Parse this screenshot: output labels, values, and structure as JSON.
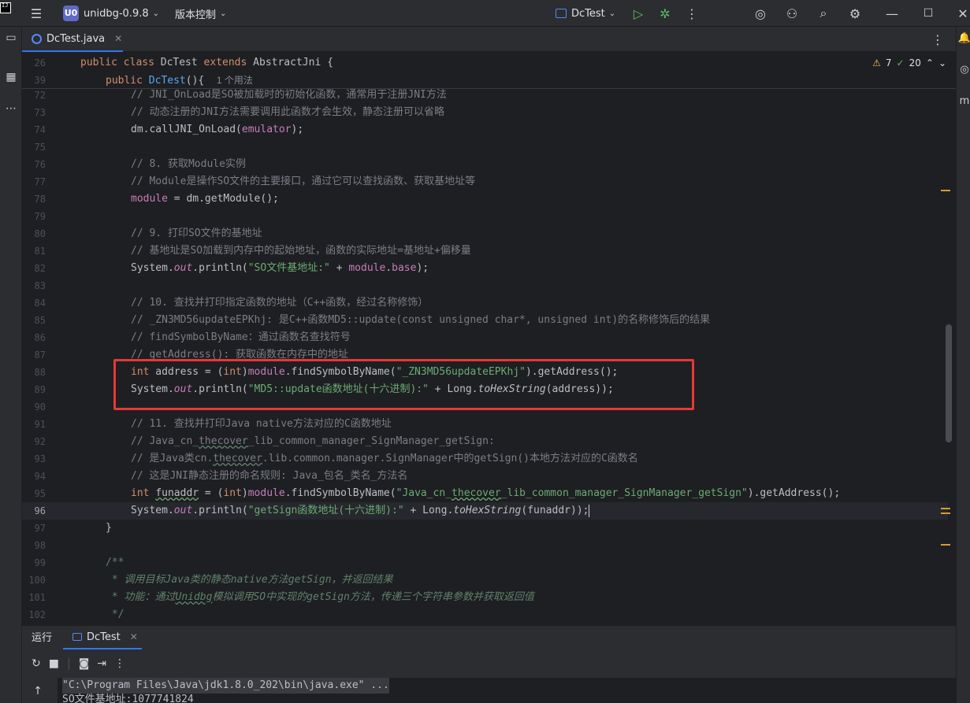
{
  "titlebar": {
    "project_badge": "U0",
    "project_name": "unidbg-0.9.8",
    "vcs_label": "版本控制",
    "run_config": "DcTest"
  },
  "tabs": [
    {
      "label": "DcTest.java",
      "active": true
    }
  ],
  "inspections": {
    "warnings": "7",
    "ok": "20"
  },
  "sticky": [
    {
      "line": "26",
      "kw1": "public class ",
      "name": "DcTest",
      "kw2": " extends ",
      "parent": "AbstractJni",
      "rest": " {"
    },
    {
      "line": "39",
      "kw": "public ",
      "name": "DcTest",
      "rest": "(){",
      "hint": "1 个用法"
    }
  ],
  "code": {
    "l72": {
      "n": "72",
      "text": "// JNI_OnLoad是SO被加载时的初始化函数，通常用于注册JNI方法"
    },
    "l73": {
      "n": "73",
      "text": "// 动态注册的JNI方法需要调用此函数才会生效，静态注册可以省略"
    },
    "l74": {
      "n": "74",
      "a": "dm.callJNI_OnLoad(",
      "b": "emulator",
      "c": ");"
    },
    "l75": {
      "n": "75"
    },
    "l76": {
      "n": "76",
      "text": "// 8. 获取Module实例"
    },
    "l77": {
      "n": "77",
      "text": "// Module是操作SO文件的主要接口，通过它可以查找函数、获取基地址等"
    },
    "l78": {
      "n": "78",
      "a": "module",
      "b": " = dm.getModule();"
    },
    "l79": {
      "n": "79"
    },
    "l80": {
      "n": "80",
      "text": "// 9. 打印SO文件的基地址"
    },
    "l81": {
      "n": "81",
      "text": "// 基地址是SO加载到内存中的起始地址，函数的实际地址=基地址+偏移量"
    },
    "l82": {
      "n": "82",
      "a": "System.",
      "b": "out",
      "c": ".println(",
      "d": "\"SO文件基地址:\"",
      "e": " + ",
      "f": "module",
      "g": ".",
      "h": "base",
      "i": ");"
    },
    "l83": {
      "n": "83"
    },
    "l84": {
      "n": "84",
      "text": "// 10. 查找并打印指定函数的地址（C++函数，经过名称修饰）"
    },
    "l85": {
      "n": "85",
      "text": "// _ZN3MD56updateEPKhj: 是C++函数MD5::update(const unsigned char*, unsigned int)的名称修饰后的结果"
    },
    "l86": {
      "n": "86",
      "text": "// findSymbolByName：通过函数名查找符号"
    },
    "l87": {
      "n": "87",
      "text": "// getAddress(): 获取函数在内存中的地址"
    },
    "l88": {
      "n": "88",
      "a": "int",
      "b": " address = (",
      "c": "int",
      "d": ")",
      "e": "module",
      "f": ".findSymbolByName(",
      "g": "\"_ZN3MD56updateEPKhj\"",
      "h": ").getAddress();"
    },
    "l89": {
      "n": "89",
      "a": "System.",
      "b": "out",
      "c": ".println(",
      "d": "\"MD5::update函数地址(十六进制):\"",
      "e": " + Long.",
      "f": "toHexString",
      "g": "(address));"
    },
    "l90": {
      "n": "90"
    },
    "l91": {
      "n": "91",
      "text": "// 11. 查找并打印Java native方法对应的C函数地址"
    },
    "l92": {
      "n": "92",
      "a": "// Java_cn_",
      "b": "thecover",
      "c": "_lib_common_manager_SignManager_getSign:"
    },
    "l93": {
      "n": "93",
      "a": "// 是Java类cn.",
      "b": "thecover",
      "c": ".lib.common.manager.SignManager中的getSign()本地方法对应的C函数名"
    },
    "l94": {
      "n": "94",
      "text": "// 这是JNI静态注册的命名规则: Java_包名_类名_方法名"
    },
    "l95": {
      "n": "95",
      "a": "int",
      "b": " ",
      "c": "funaddr",
      "d": " = (",
      "e": "int",
      "f": ")",
      "g": "module",
      "h": ".findSymbolByName(",
      "i": "\"Java_cn_",
      "j": "thecover",
      "k": "_lib_common_manager_SignManager_getSign\"",
      "l": ").getAddress();"
    },
    "l96": {
      "n": "96",
      "a": "System.",
      "b": "out",
      "c": ".println(",
      "d": "\"getSign函数地址(十六进制):\"",
      "e": " + Long.",
      "f": "toHexString",
      "g": "(funaddr));"
    },
    "l97": {
      "n": "97",
      "text": "}"
    },
    "l98": {
      "n": "98"
    },
    "l99": {
      "n": "99",
      "text": "/**"
    },
    "l100": {
      "n": "100",
      "a": " * ",
      "b": "调用目标Java类的静态native方法getSign，并返回结果"
    },
    "l101": {
      "n": "101",
      "a": " * ",
      "b": "功能：通过",
      "c": "Unidbg",
      "d": "模拟调用SO中实现的getSign方法，传递三个字符串参数并获取返回值"
    },
    "l102": {
      "n": "102",
      "text": " */"
    }
  },
  "run_panel": {
    "title": "运行",
    "tab": "DcTest",
    "console": [
      "\"C:\\Program Files\\Java\\jdk1.8.0_202\\bin\\java.exe\" ...",
      "SO文件基地址:1077741824"
    ]
  },
  "colors": {
    "accent": "#3574f0",
    "highlight_box": "#e53935",
    "background": "#1e1f22",
    "panel": "#2b2d30"
  }
}
